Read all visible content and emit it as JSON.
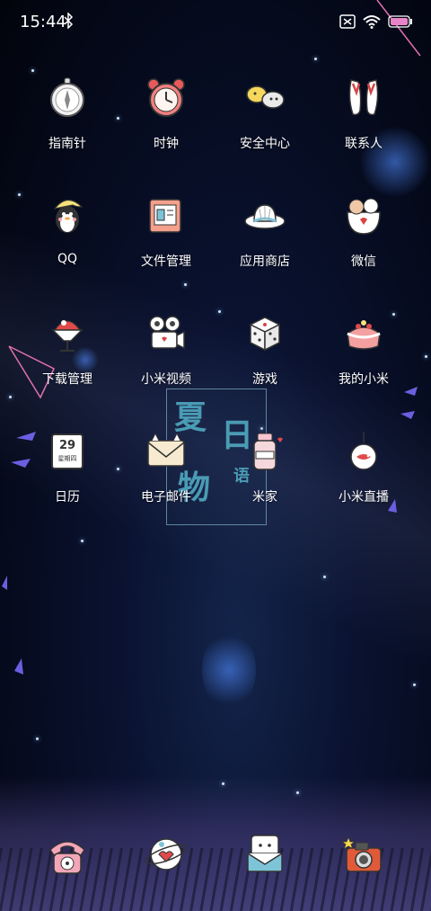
{
  "status_bar": {
    "time": "15:44",
    "icons": [
      "bluetooth-icon",
      "sim-card-icon",
      "wifi-icon",
      "battery-icon"
    ]
  },
  "apps": [
    {
      "label": "指南针",
      "icon": "compass-icon"
    },
    {
      "label": "时钟",
      "icon": "alarm-clock-icon"
    },
    {
      "label": "安全中心",
      "icon": "security-center-icon"
    },
    {
      "label": "联系人",
      "icon": "contacts-icon"
    },
    {
      "label": "QQ",
      "icon": "qq-penguin-icon"
    },
    {
      "label": "文件管理",
      "icon": "file-manager-icon"
    },
    {
      "label": "应用商店",
      "icon": "app-store-icon"
    },
    {
      "label": "微信",
      "icon": "wechat-icon"
    },
    {
      "label": "下载管理",
      "icon": "download-manager-icon"
    },
    {
      "label": "小米视频",
      "icon": "mi-video-icon"
    },
    {
      "label": "游戏",
      "icon": "game-dice-icon"
    },
    {
      "label": "我的小米",
      "icon": "my-xiaomi-icon"
    },
    {
      "label": "日历",
      "icon": "calendar-icon"
    },
    {
      "label": "电子邮件",
      "icon": "email-icon"
    },
    {
      "label": "米家",
      "icon": "mijia-icon"
    },
    {
      "label": "小米直播",
      "icon": "mi-live-icon"
    }
  ],
  "calendar_icon": {
    "day": "29",
    "weekday": "星期四"
  },
  "widget": {
    "chars": [
      "夏",
      "日",
      "物",
      "语"
    ]
  },
  "dock": [
    {
      "icon": "phone-icon"
    },
    {
      "icon": "messages-icon"
    },
    {
      "icon": "browser-icon"
    },
    {
      "icon": "camera-icon"
    }
  ]
}
